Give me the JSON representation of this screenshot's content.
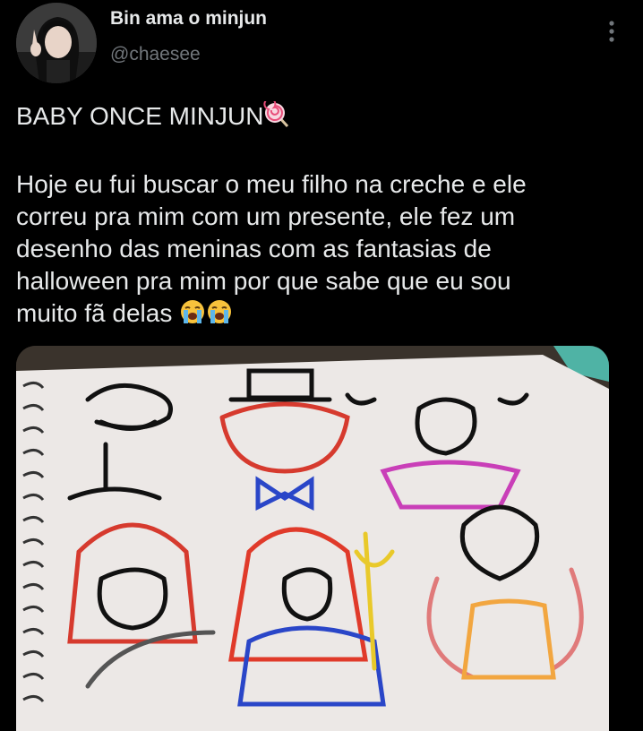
{
  "author": {
    "display_name": "Bin ama o minjun",
    "handle": "@chaesee",
    "avatar_icon": "avatar-photo"
  },
  "menu_icon": "more-vertical-icon",
  "tweet": {
    "line1": "BABY ONCE MINJUN",
    "line1_emoji": "lollipop",
    "body": [
      "Hoje eu fui buscar o meu filho na creche e ele",
      "correu pra mim com um presente, ele fez um",
      "desenho das meninas com as fantasias de",
      "halloween pra mim por que sabe que eu sou",
      "muito fã delas"
    ],
    "body_emoji": [
      "loudly-crying-face",
      "loudly-crying-face"
    ]
  },
  "media": {
    "type": "photo",
    "subject": "child drawing on spiral sketchbook"
  },
  "colors": {
    "background": "#000000",
    "text": "#e7e9ea",
    "secondary": "#71767b"
  }
}
